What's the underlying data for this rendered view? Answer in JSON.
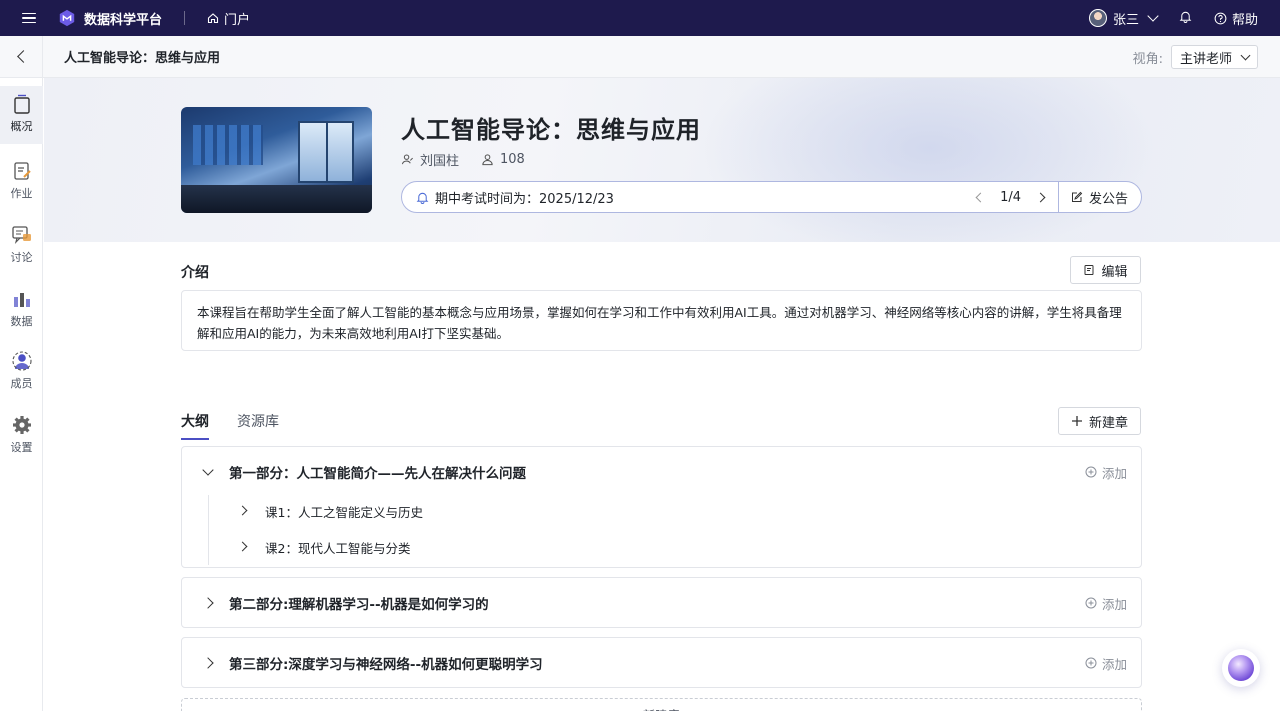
{
  "topbar": {
    "app_name": "数据科学平台",
    "portal_label": "门户",
    "user_name": "张三",
    "help_label": "帮助"
  },
  "subheader": {
    "breadcrumb": "人工智能导论：思维与应用",
    "view_label": "视角:",
    "view_value": "主讲老师"
  },
  "rail": {
    "items": [
      {
        "label": "概况",
        "icon": "book-icon",
        "active": true
      },
      {
        "label": "作业",
        "icon": "assignment-icon"
      },
      {
        "label": "讨论",
        "icon": "discussion-icon"
      },
      {
        "label": "数据",
        "icon": "data-icon"
      },
      {
        "label": "成员",
        "icon": "members-icon"
      },
      {
        "label": "设置",
        "icon": "gear-icon"
      }
    ]
  },
  "course": {
    "title": "人工智能导论：思维与应用",
    "teacher": "刘国柱",
    "student_count": "108",
    "notice": "期中考试时间为：2025/12/23",
    "notice_page": "1/4",
    "post_label": "发公告"
  },
  "intro": {
    "title": "介绍",
    "edit_label": "编辑",
    "text": "本课程旨在帮助学生全面了解人工智能的基本概念与应用场景，掌握如何在学习和工作中有效利用AI工具。通过对机器学习、神经网络等核心内容的讲解，学生将具备理解和应用AI的能力，为未来高效地利用AI打下坚实基础。"
  },
  "tabs": [
    {
      "label": "大纲",
      "active": true
    },
    {
      "label": "资源库"
    }
  ],
  "outline": {
    "new_chapter_label": "新建章",
    "add_label": "添加",
    "chapters": [
      {
        "title": "第一部分：人工智能简介——先人在解决什么问题",
        "expanded": true,
        "lessons": [
          "课1：人工之智能定义与历史",
          "课2：现代人工智能与分类"
        ]
      },
      {
        "title": "第二部分:理解机器学习--机器是如何学习的",
        "expanded": false
      },
      {
        "title": "第三部分:深度学习与神经网络--机器如何更聪明学习",
        "expanded": false
      }
    ]
  },
  "colors": {
    "topbar": "#1e1a4d",
    "accent": "#4b4fc4",
    "notice_border": "#aeb7e0"
  }
}
